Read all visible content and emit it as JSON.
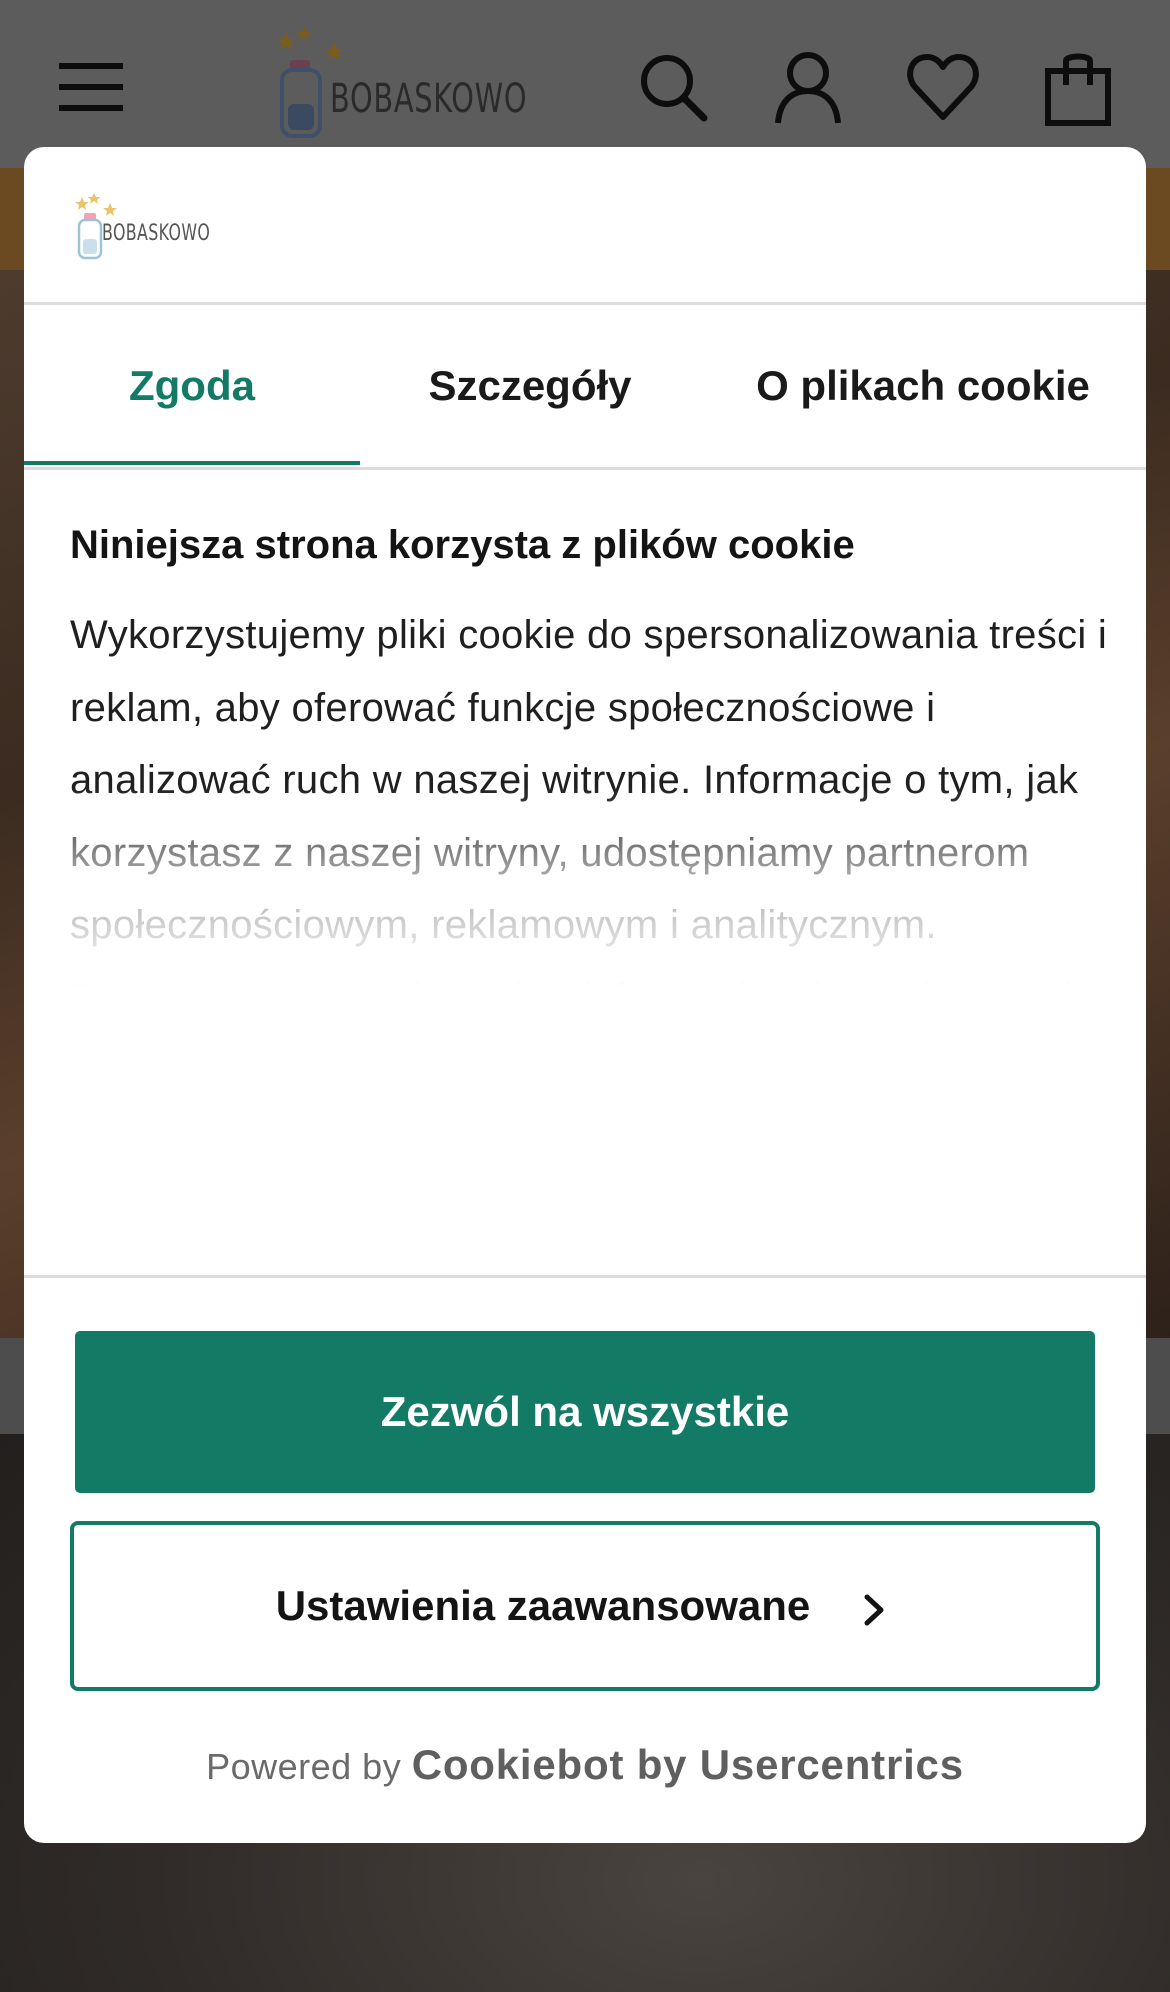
{
  "site": {
    "logo_text": "BOBASKOWO",
    "header_icons": [
      "menu-icon",
      "search-icon",
      "account-icon",
      "heart-icon",
      "cart-icon"
    ]
  },
  "cookie_dialog": {
    "logo_text": "BOBASKOWO",
    "tabs": [
      {
        "label": "Zgoda",
        "active": true
      },
      {
        "label": "Szczegóły",
        "active": false
      },
      {
        "label": "O plikach cookie",
        "active": false
      }
    ],
    "heading": "Niniejsza strona korzysta z plików cookie",
    "body": "Wykorzystujemy pliki cookie do spersonalizowania treści i reklam, aby oferować funkcje społecznościowe i analizować ruch w naszej witrynie. Informacje o tym, jak korzystasz z naszej witryny, udostępniamy partnerom społecznościowym, reklamowym i analitycznym. Partnerzy mogą połączyć te informacje z innymi danymi otrzymanymi od Ciebie lub uzyskanymi podczas korzystania z",
    "allow_all_label": "Zezwól na wszystkie",
    "advanced_label": "Ustawienia zaawansowane",
    "powered_prefix": "Powered by",
    "powered_brand": "Cookiebot by Usercentrics"
  },
  "colors": {
    "accent": "#137a66",
    "overlay_header": "#5c5c5c",
    "dialog_bg": "#ffffff"
  }
}
